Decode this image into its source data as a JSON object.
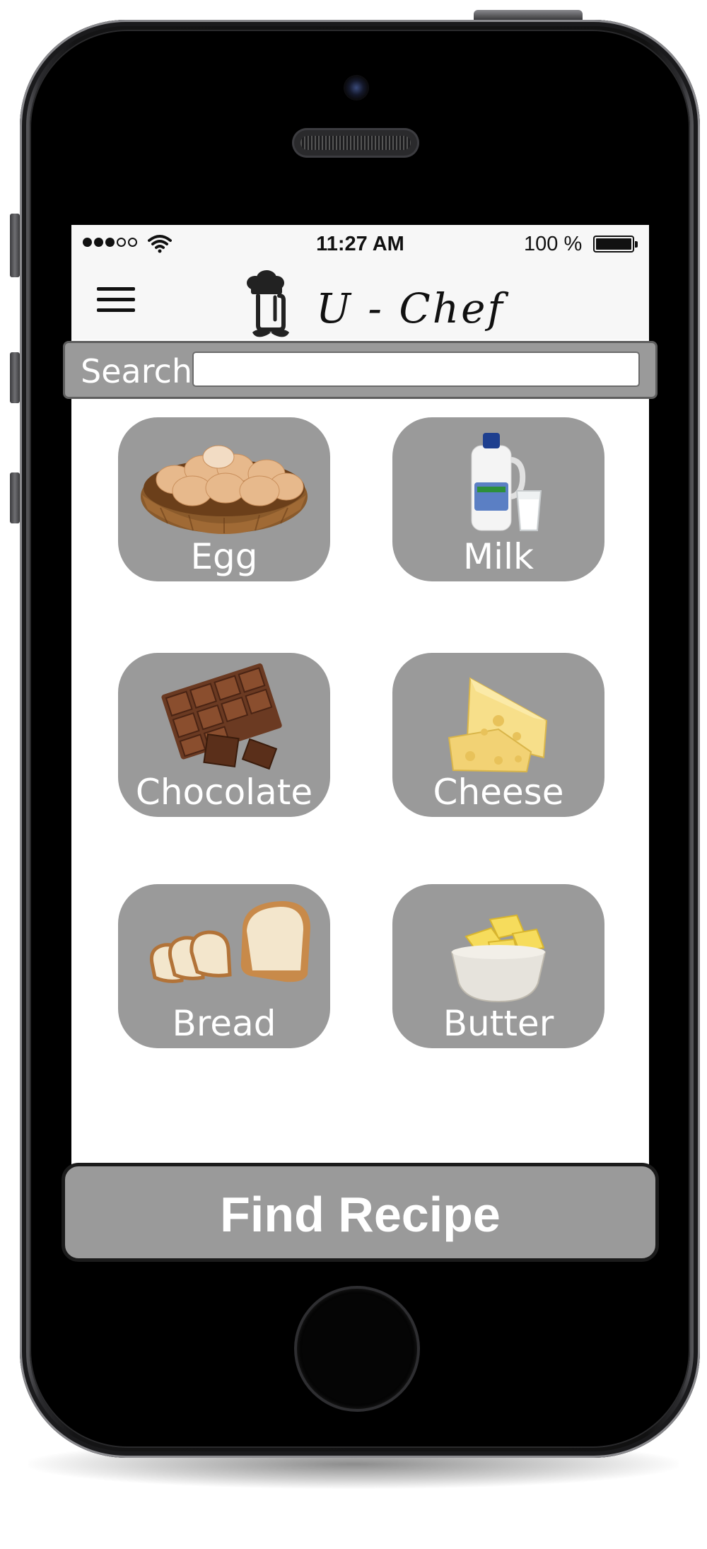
{
  "status_bar": {
    "time": "11:27 AM",
    "battery_percent": "100 %",
    "signal_bars_filled": 3,
    "signal_bars_total": 5
  },
  "app": {
    "title": "U - Chef",
    "logo_icon": "chef-hat-mustache-icon",
    "menu_icon": "hamburger-menu-icon"
  },
  "search": {
    "label": "Search",
    "value": "",
    "placeholder": ""
  },
  "ingredients": [
    {
      "label": "Egg",
      "icon": "egg-basket-icon"
    },
    {
      "label": "Milk",
      "icon": "milk-jug-icon"
    },
    {
      "label": "Chocolate",
      "icon": "chocolate-bar-icon"
    },
    {
      "label": "Cheese",
      "icon": "cheese-icon"
    },
    {
      "label": "Bread",
      "icon": "bread-loaf-icon"
    },
    {
      "label": "Butter",
      "icon": "butter-bowl-icon"
    }
  ],
  "actions": {
    "find_recipe_label": "Find Recipe"
  },
  "colors": {
    "card_background": "#9a9a9a",
    "screen_background": "#ffffff",
    "bar_background": "#f7f7f7",
    "label_text": "#ffffff",
    "device_frame": "#111111"
  }
}
